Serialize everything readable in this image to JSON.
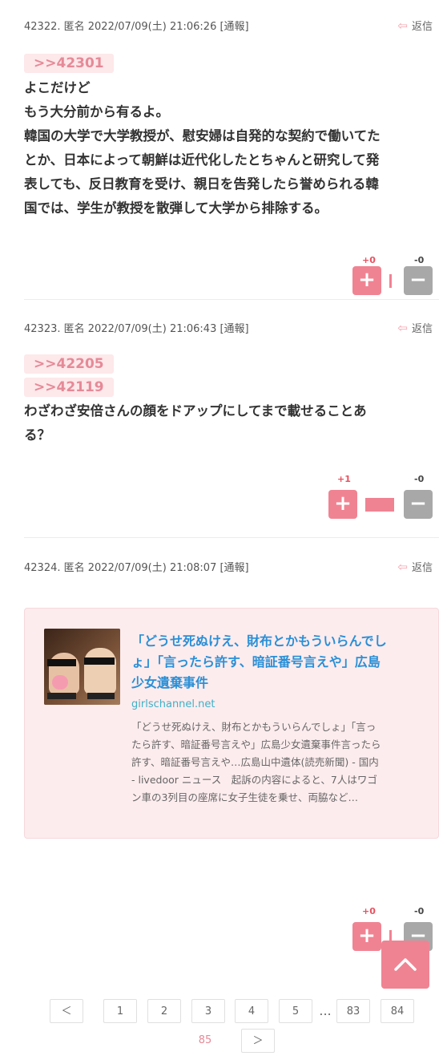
{
  "comments": [
    {
      "meta": "42322. 匿名 2022/07/09(土) 21:06:26  [通報]",
      "reply": "返信",
      "anchors": [
        ">>42301"
      ],
      "body": [
        "よこだけど",
        "もう大分前から有るよ。",
        "韓国の大学で大学教授が、慰安婦は自発的な契約で働いてた",
        "とか、日本によって朝鮮は近代化したとちゃんと研究して発",
        "表しても、反日教育を受け、親日を告発したら誉められる韓",
        "国では、学生が教授を散弾して大学から排除する。"
      ],
      "plus": "+0",
      "minus": "-0"
    },
    {
      "meta": "42323. 匿名 2022/07/09(土) 21:06:43  [通報]",
      "reply": "返信",
      "anchors": [
        ">>42205",
        ">>42119"
      ],
      "body": [
        "わざわざ安倍さんの顔をドアップにしてまで載せることあ",
        "る？"
      ],
      "plus": "+1",
      "minus": "-0"
    },
    {
      "meta": "42324. 匿名 2022/07/09(土) 21:08:07  [通報]",
      "reply": "返信",
      "plus": "+0",
      "minus": "-0"
    }
  ],
  "link_card": {
    "title": [
      "「どうせ死ぬけえ、財布とかもういらんでし",
      "ょ」「言ったら許す、暗証番号言えや」広島",
      "少女遺棄事件"
    ],
    "domain": "girlschannel.net",
    "desc": [
      "「どうせ死ぬけえ、財布とかもういらんでしょ」「言っ",
      "たら許す、暗証番号言えや」広島少女遺棄事件言ったら",
      "許す、暗証番号言えや…広島山中遺体(読売新聞) - 国内",
      "- livedoor ニュース　起訴の内容によると、7人はワゴ",
      "ン車の3列目の座席に女子生徒を乗せ、両脇など…"
    ]
  },
  "vote_buttons": {
    "plus": "+",
    "minus": "−"
  },
  "pagination": {
    "prev": "＜",
    "pages": [
      "1",
      "2",
      "3",
      "4",
      "5"
    ],
    "ellipsis": "...",
    "pages_tail": [
      "83",
      "84"
    ],
    "current": "85",
    "next": "＞"
  },
  "icons": {
    "reply": "reply-arrow-icon",
    "top": "chevron-up-icon"
  },
  "colors": {
    "accent": "#f08392",
    "link": "#2a8fd6",
    "domain": "#3db1c8"
  }
}
